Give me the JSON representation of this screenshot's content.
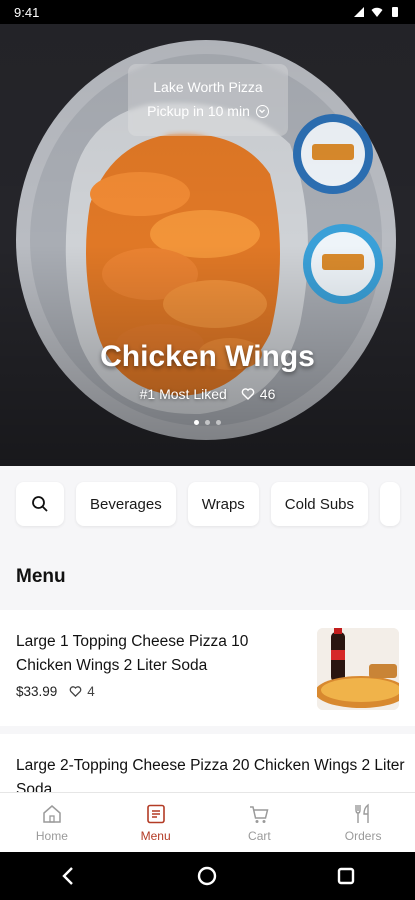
{
  "status_bar": {
    "time": "9:41"
  },
  "hero": {
    "store_name": "Lake Worth Pizza",
    "pickup": "Pickup in 10 min",
    "title": "Chicken Wings",
    "rank": "#1 Most Liked",
    "likes": "46",
    "carousel_pages": 3,
    "carousel_active": 1
  },
  "categories": [
    "Beverages",
    "Wraps",
    "Cold Subs"
  ],
  "menu": {
    "heading": "Menu",
    "items": [
      {
        "name": "Large 1 Topping Cheese Pizza 10 Chicken Wings 2 Liter Soda",
        "price": "$33.99",
        "likes": "4"
      },
      {
        "name": "Large 2-Topping Cheese Pizza 20 Chicken Wings 2 Liter Soda"
      }
    ]
  },
  "tabs": [
    {
      "label": "Home",
      "icon": "home-icon",
      "active": false
    },
    {
      "label": "Menu",
      "icon": "menu-icon",
      "active": true
    },
    {
      "label": "Cart",
      "icon": "cart-icon",
      "active": false
    },
    {
      "label": "Orders",
      "icon": "fork-knife-icon",
      "active": false
    }
  ],
  "colors": {
    "accent": "#b33b25",
    "inactive": "#9a9a9a",
    "sauce": "#e8782a"
  }
}
